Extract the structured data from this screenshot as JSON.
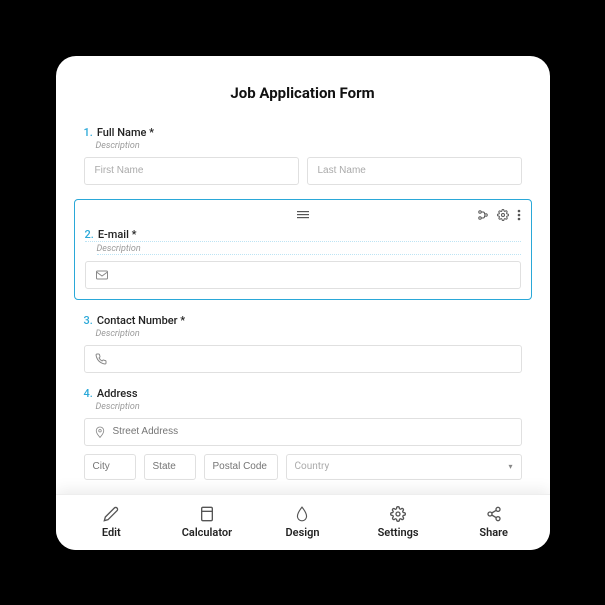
{
  "form": {
    "title": "Job Application Form",
    "fields": {
      "fullname": {
        "num": "1.",
        "label": "Full Name *",
        "desc": "Description",
        "first_ph": "First Name",
        "last_ph": "Last Name"
      },
      "email": {
        "num": "2.",
        "label": "E-mail *",
        "desc": "Description"
      },
      "contact": {
        "num": "3.",
        "label": "Contact Number *",
        "desc": "Description"
      },
      "address": {
        "num": "4.",
        "label": "Address",
        "desc": "Description",
        "street_ph": "Street Address",
        "city_ph": "City",
        "state_ph": "State",
        "postal_ph": "Postal Code",
        "country_ph": "Country"
      }
    }
  },
  "nav": {
    "edit": "Edit",
    "calculator": "Calculator",
    "design": "Design",
    "settings": "Settings",
    "share": "Share"
  }
}
